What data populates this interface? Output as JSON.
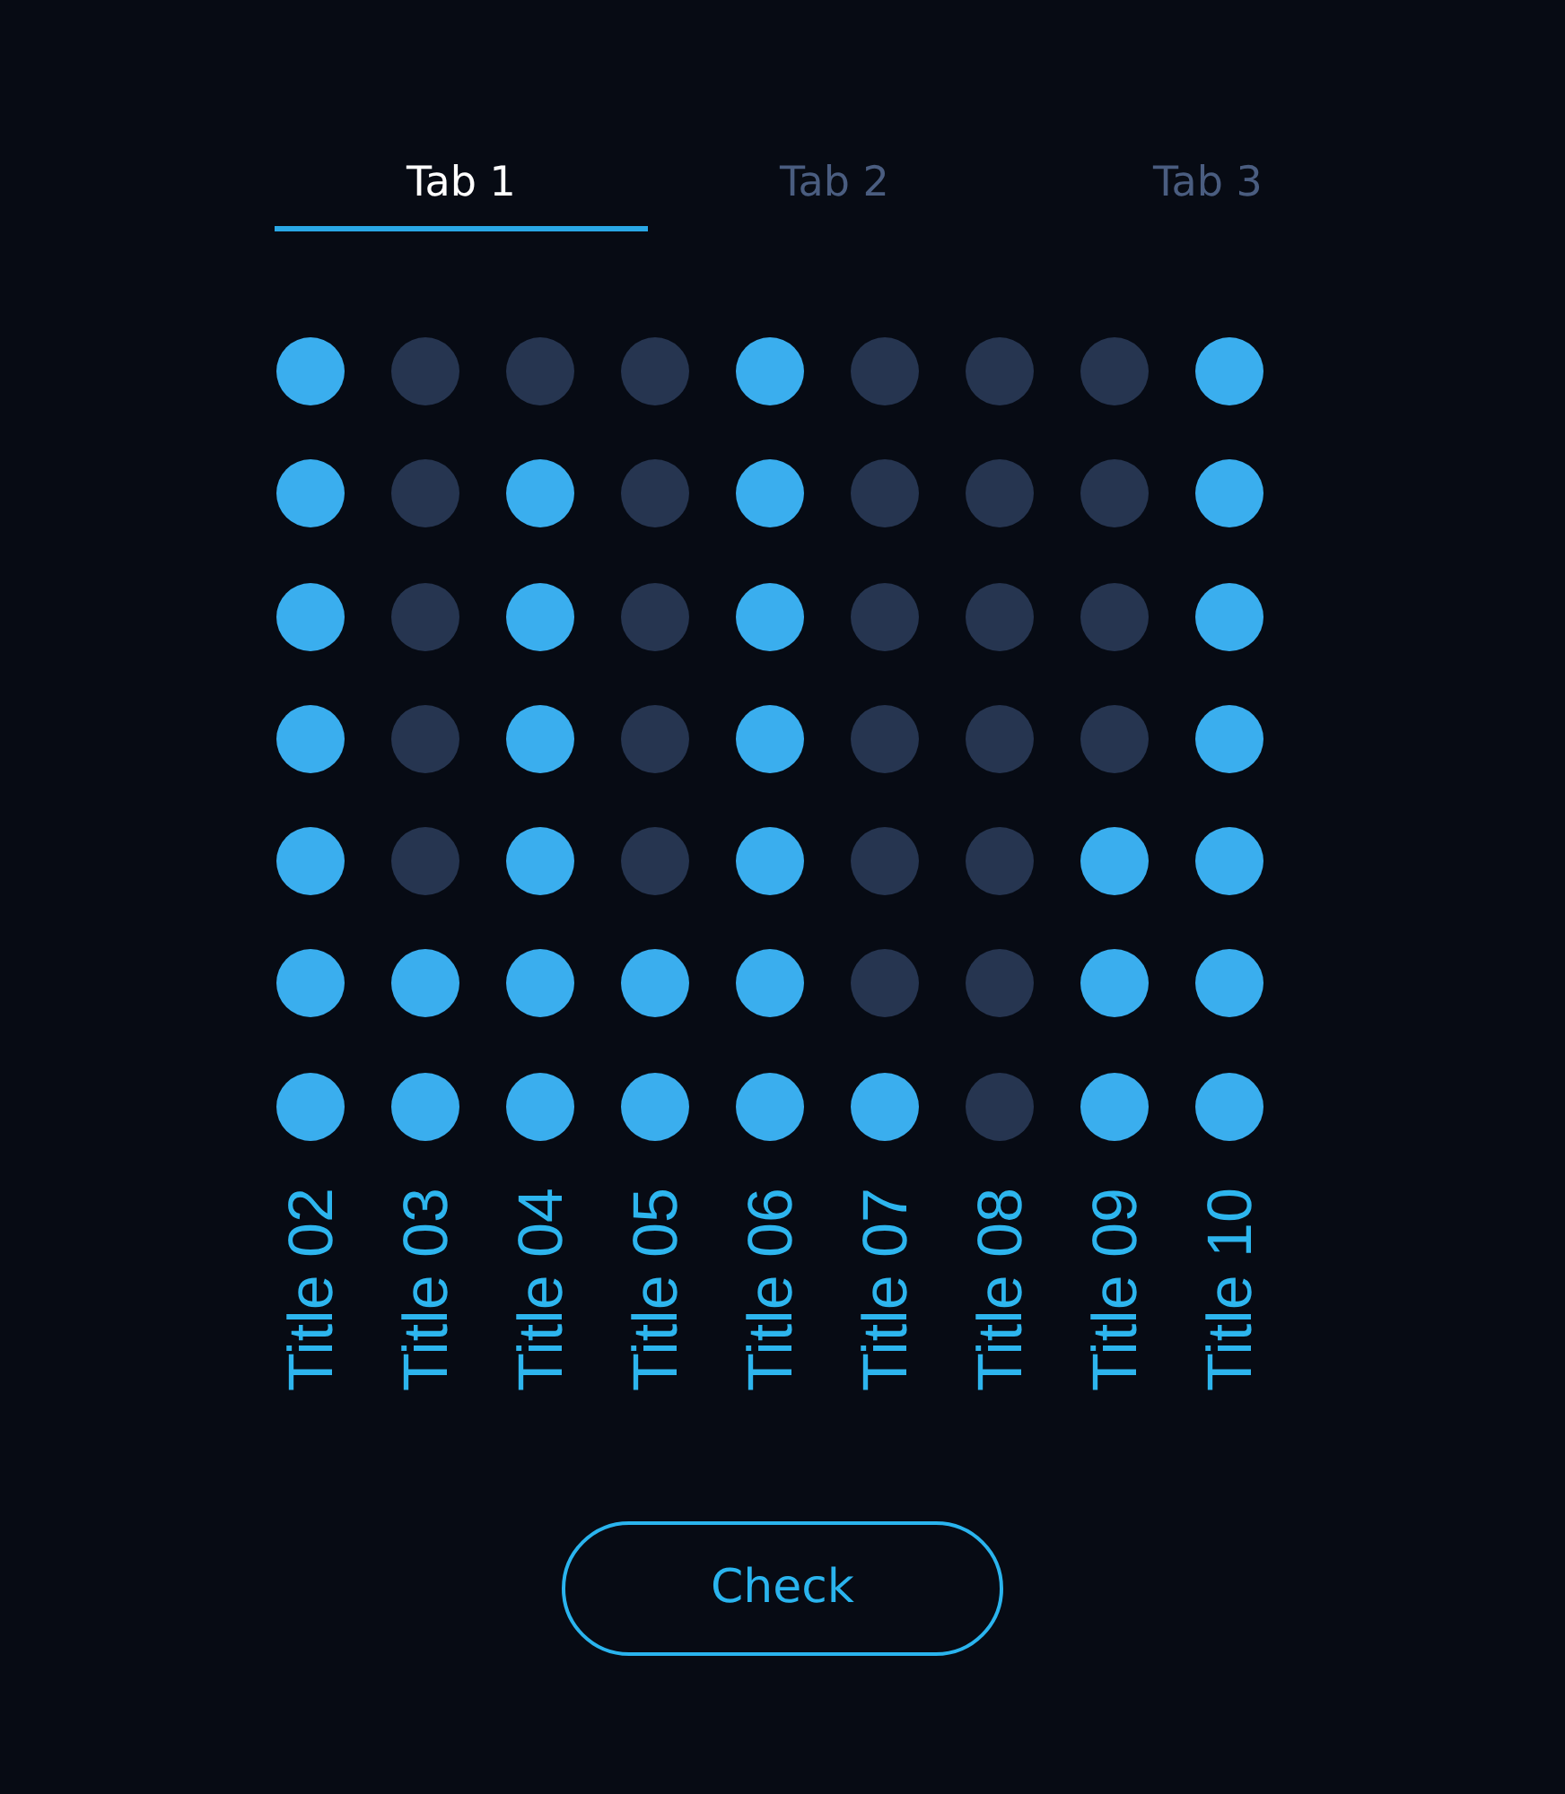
{
  "tabs": [
    {
      "label": "Tab 1",
      "selected": true
    },
    {
      "label": "Tab 2",
      "selected": false
    },
    {
      "label": "Tab 3",
      "selected": false
    }
  ],
  "columns": [
    {
      "label": "Title 02",
      "dots": [
        {
          "on": true
        },
        {
          "on": true
        },
        {
          "on": true
        },
        {
          "on": true
        },
        {
          "on": true
        },
        {
          "on": true
        },
        {
          "on": true
        }
      ]
    },
    {
      "label": "Title 03",
      "dots": [
        {
          "on": false
        },
        {
          "on": false
        },
        {
          "on": false
        },
        {
          "on": false
        },
        {
          "on": false
        },
        {
          "on": true
        },
        {
          "on": true
        }
      ]
    },
    {
      "label": "Title 04",
      "dots": [
        {
          "on": false
        },
        {
          "on": true
        },
        {
          "on": true
        },
        {
          "on": true
        },
        {
          "on": true
        },
        {
          "on": true
        },
        {
          "on": true
        }
      ]
    },
    {
      "label": "Title 05",
      "dots": [
        {
          "on": false
        },
        {
          "on": false
        },
        {
          "on": false
        },
        {
          "on": false
        },
        {
          "on": false
        },
        {
          "on": true
        },
        {
          "on": true
        }
      ]
    },
    {
      "label": "Title 06",
      "dots": [
        {
          "on": true
        },
        {
          "on": true
        },
        {
          "on": true
        },
        {
          "on": true
        },
        {
          "on": true
        },
        {
          "on": true
        },
        {
          "on": true
        }
      ]
    },
    {
      "label": "Title 07",
      "dots": [
        {
          "on": false
        },
        {
          "on": false
        },
        {
          "on": false
        },
        {
          "on": false
        },
        {
          "on": false
        },
        {
          "on": false
        },
        {
          "on": true
        }
      ]
    },
    {
      "label": "Title 08",
      "dots": [
        {
          "on": false
        },
        {
          "on": false
        },
        {
          "on": false
        },
        {
          "on": false
        },
        {
          "on": false
        },
        {
          "on": false
        },
        {
          "on": false
        }
      ]
    },
    {
      "label": "Title 09",
      "dots": [
        {
          "on": false
        },
        {
          "on": false
        },
        {
          "on": false
        },
        {
          "on": false
        },
        {
          "on": true
        },
        {
          "on": true
        },
        {
          "on": true
        }
      ]
    },
    {
      "label": "Title 10",
      "dots": [
        {
          "on": true
        },
        {
          "on": true
        },
        {
          "on": true
        },
        {
          "on": true
        },
        {
          "on": true
        },
        {
          "on": true
        },
        {
          "on": true
        }
      ]
    }
  ],
  "button": {
    "label": "Check"
  }
}
